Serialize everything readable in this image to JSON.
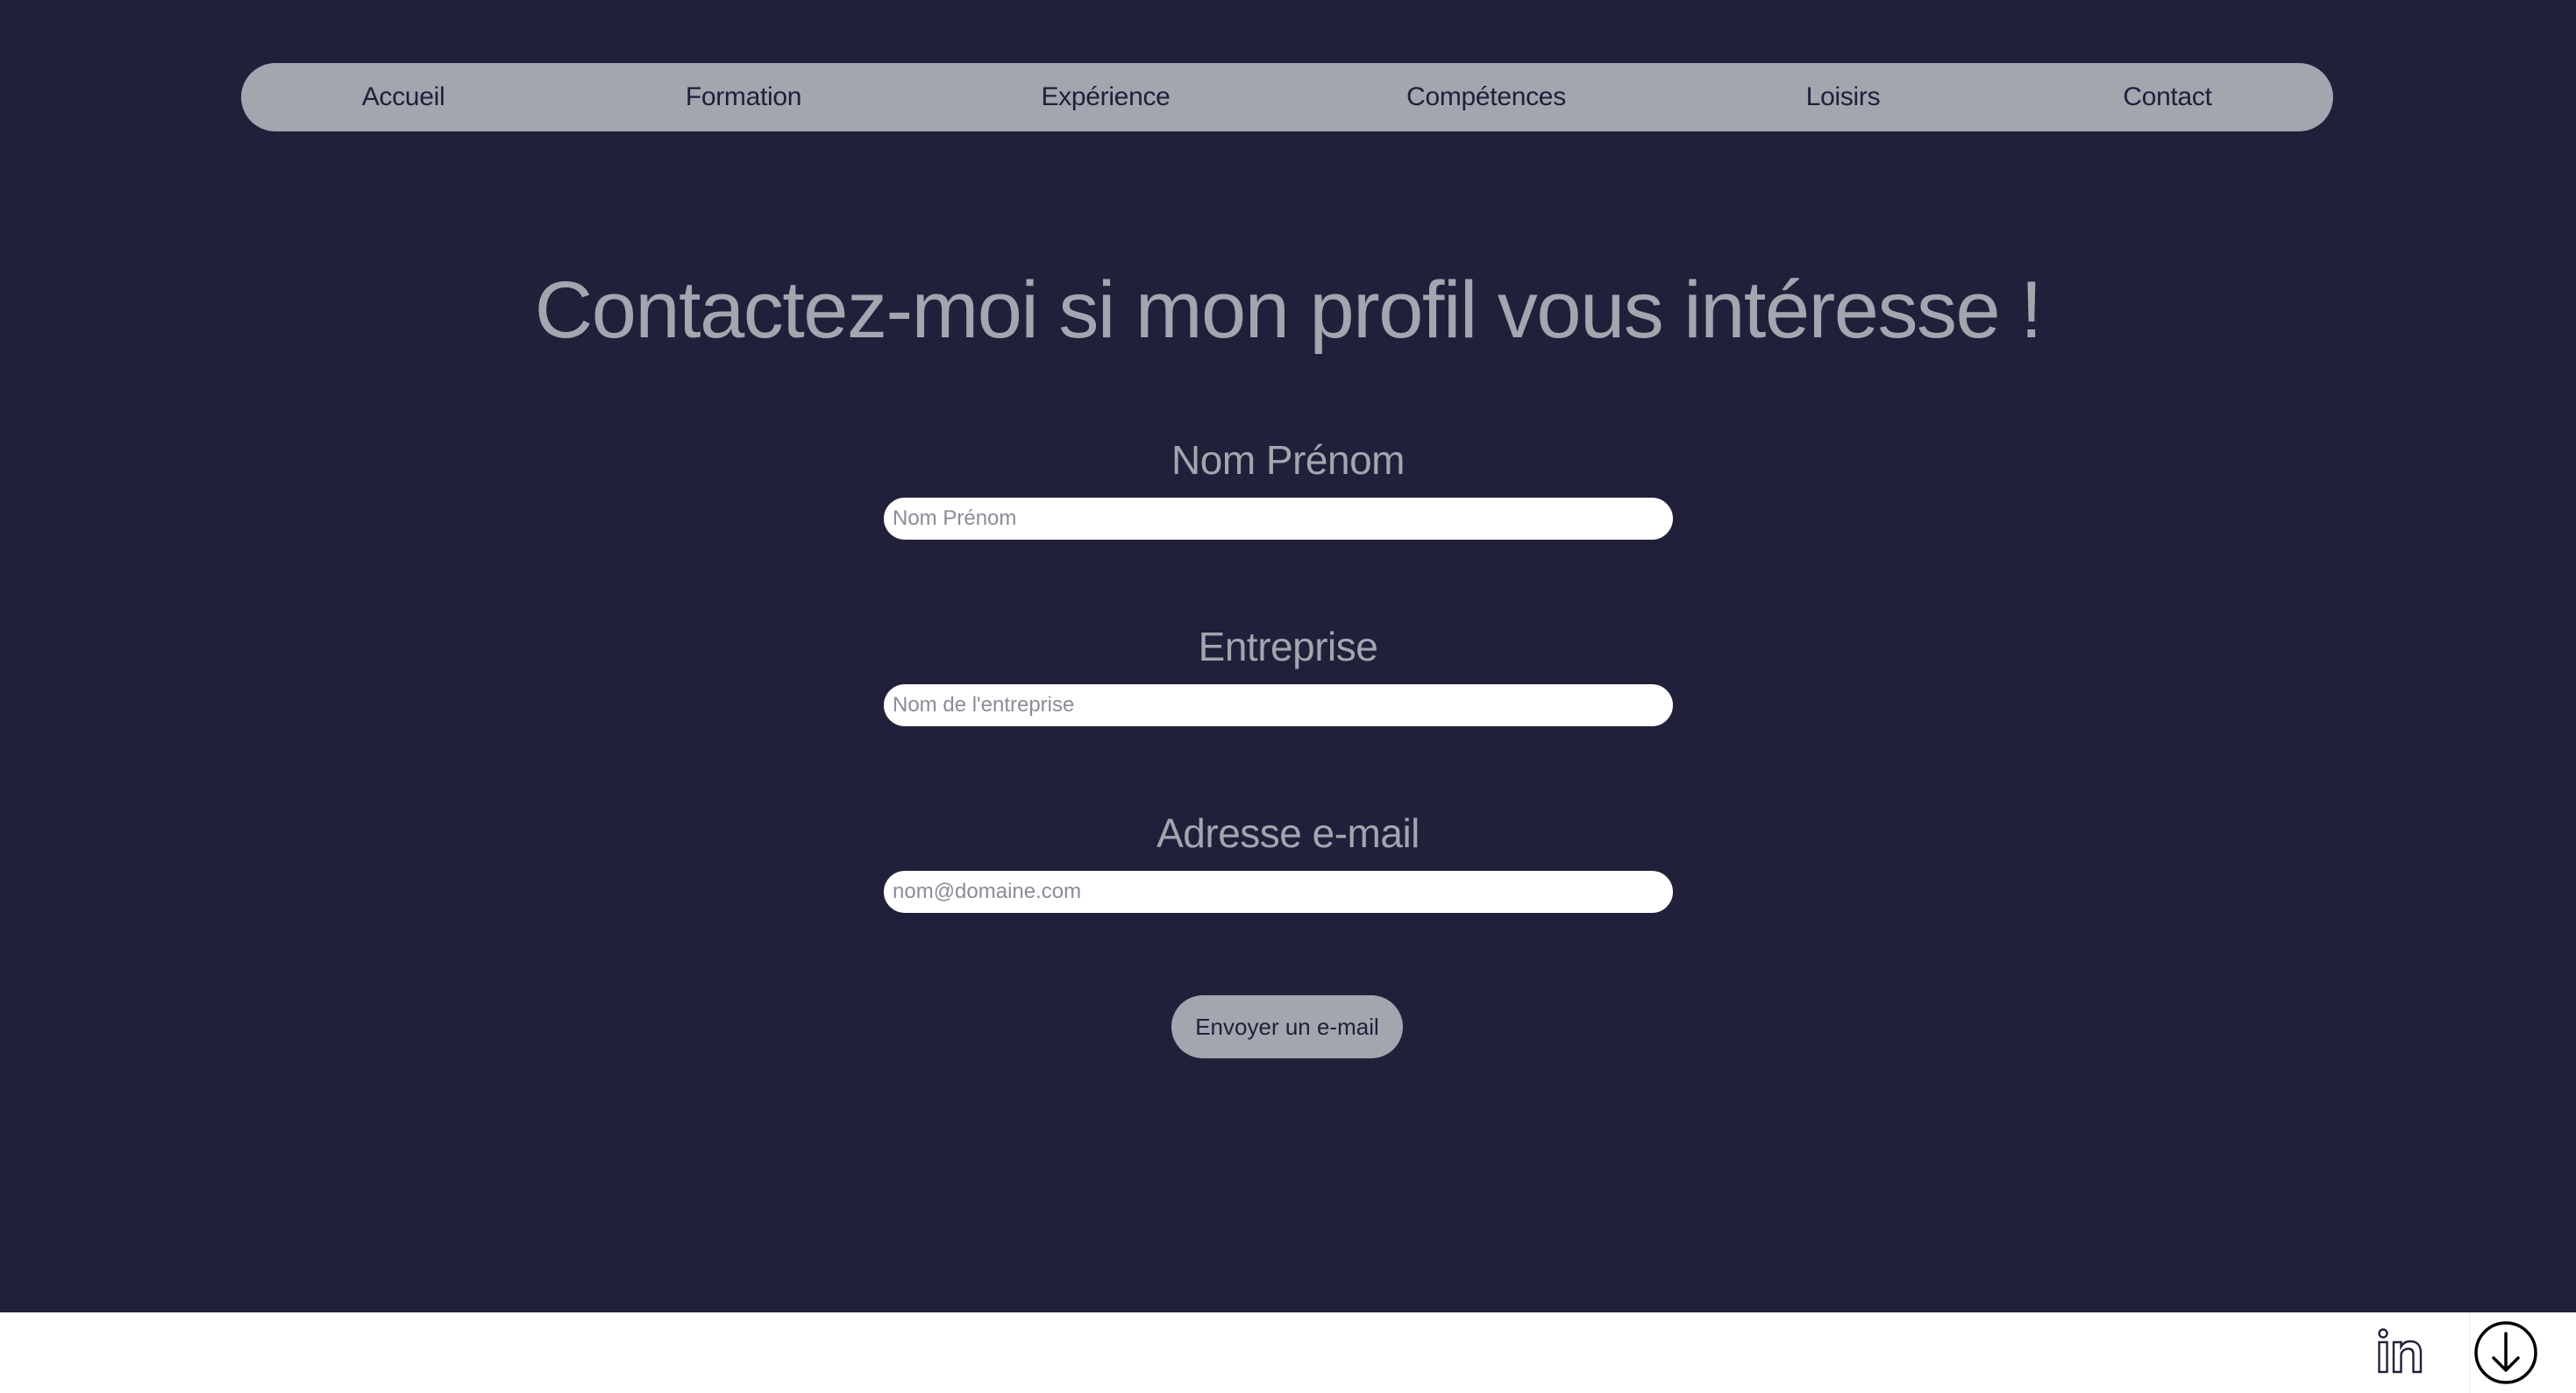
{
  "nav": {
    "items": [
      {
        "label": "Accueil"
      },
      {
        "label": "Formation"
      },
      {
        "label": "Expérience"
      },
      {
        "label": "Compétences"
      },
      {
        "label": "Loisirs"
      },
      {
        "label": "Contact"
      }
    ]
  },
  "main": {
    "title": "Contactez-moi si mon profil vous intéresse !"
  },
  "form": {
    "name": {
      "label": "Nom Prénom",
      "placeholder": "Nom Prénom",
      "value": ""
    },
    "company": {
      "label": "Entreprise",
      "placeholder": "Nom de l'entreprise",
      "value": ""
    },
    "email": {
      "label": "Adresse e-mail",
      "placeholder": "nom@domaine.com",
      "value": ""
    },
    "submit_label": "Envoyer un e-mail"
  },
  "footer": {
    "icons": [
      "linkedin-icon",
      "download-icon"
    ]
  },
  "colors": {
    "background": "#20203a",
    "accent": "#a3a5af",
    "footer": "#ffffff"
  }
}
